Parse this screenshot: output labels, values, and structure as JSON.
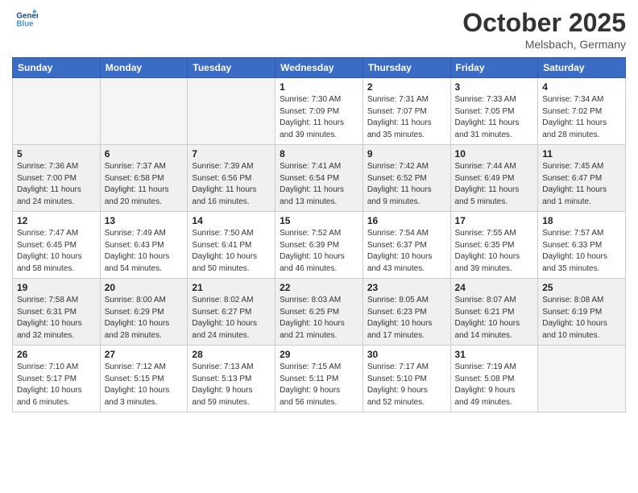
{
  "header": {
    "logo_line1": "General",
    "logo_line2": "Blue",
    "month_title": "October 2025",
    "location": "Melsbach, Germany"
  },
  "days_of_week": [
    "Sunday",
    "Monday",
    "Tuesday",
    "Wednesday",
    "Thursday",
    "Friday",
    "Saturday"
  ],
  "weeks": [
    [
      {
        "day": "",
        "info": ""
      },
      {
        "day": "",
        "info": ""
      },
      {
        "day": "",
        "info": ""
      },
      {
        "day": "1",
        "info": "Sunrise: 7:30 AM\nSunset: 7:09 PM\nDaylight: 11 hours\nand 39 minutes."
      },
      {
        "day": "2",
        "info": "Sunrise: 7:31 AM\nSunset: 7:07 PM\nDaylight: 11 hours\nand 35 minutes."
      },
      {
        "day": "3",
        "info": "Sunrise: 7:33 AM\nSunset: 7:05 PM\nDaylight: 11 hours\nand 31 minutes."
      },
      {
        "day": "4",
        "info": "Sunrise: 7:34 AM\nSunset: 7:02 PM\nDaylight: 11 hours\nand 28 minutes."
      }
    ],
    [
      {
        "day": "5",
        "info": "Sunrise: 7:36 AM\nSunset: 7:00 PM\nDaylight: 11 hours\nand 24 minutes."
      },
      {
        "day": "6",
        "info": "Sunrise: 7:37 AM\nSunset: 6:58 PM\nDaylight: 11 hours\nand 20 minutes."
      },
      {
        "day": "7",
        "info": "Sunrise: 7:39 AM\nSunset: 6:56 PM\nDaylight: 11 hours\nand 16 minutes."
      },
      {
        "day": "8",
        "info": "Sunrise: 7:41 AM\nSunset: 6:54 PM\nDaylight: 11 hours\nand 13 minutes."
      },
      {
        "day": "9",
        "info": "Sunrise: 7:42 AM\nSunset: 6:52 PM\nDaylight: 11 hours\nand 9 minutes."
      },
      {
        "day": "10",
        "info": "Sunrise: 7:44 AM\nSunset: 6:49 PM\nDaylight: 11 hours\nand 5 minutes."
      },
      {
        "day": "11",
        "info": "Sunrise: 7:45 AM\nSunset: 6:47 PM\nDaylight: 11 hours\nand 1 minute."
      }
    ],
    [
      {
        "day": "12",
        "info": "Sunrise: 7:47 AM\nSunset: 6:45 PM\nDaylight: 10 hours\nand 58 minutes."
      },
      {
        "day": "13",
        "info": "Sunrise: 7:49 AM\nSunset: 6:43 PM\nDaylight: 10 hours\nand 54 minutes."
      },
      {
        "day": "14",
        "info": "Sunrise: 7:50 AM\nSunset: 6:41 PM\nDaylight: 10 hours\nand 50 minutes."
      },
      {
        "day": "15",
        "info": "Sunrise: 7:52 AM\nSunset: 6:39 PM\nDaylight: 10 hours\nand 46 minutes."
      },
      {
        "day": "16",
        "info": "Sunrise: 7:54 AM\nSunset: 6:37 PM\nDaylight: 10 hours\nand 43 minutes."
      },
      {
        "day": "17",
        "info": "Sunrise: 7:55 AM\nSunset: 6:35 PM\nDaylight: 10 hours\nand 39 minutes."
      },
      {
        "day": "18",
        "info": "Sunrise: 7:57 AM\nSunset: 6:33 PM\nDaylight: 10 hours\nand 35 minutes."
      }
    ],
    [
      {
        "day": "19",
        "info": "Sunrise: 7:58 AM\nSunset: 6:31 PM\nDaylight: 10 hours\nand 32 minutes."
      },
      {
        "day": "20",
        "info": "Sunrise: 8:00 AM\nSunset: 6:29 PM\nDaylight: 10 hours\nand 28 minutes."
      },
      {
        "day": "21",
        "info": "Sunrise: 8:02 AM\nSunset: 6:27 PM\nDaylight: 10 hours\nand 24 minutes."
      },
      {
        "day": "22",
        "info": "Sunrise: 8:03 AM\nSunset: 6:25 PM\nDaylight: 10 hours\nand 21 minutes."
      },
      {
        "day": "23",
        "info": "Sunrise: 8:05 AM\nSunset: 6:23 PM\nDaylight: 10 hours\nand 17 minutes."
      },
      {
        "day": "24",
        "info": "Sunrise: 8:07 AM\nSunset: 6:21 PM\nDaylight: 10 hours\nand 14 minutes."
      },
      {
        "day": "25",
        "info": "Sunrise: 8:08 AM\nSunset: 6:19 PM\nDaylight: 10 hours\nand 10 minutes."
      }
    ],
    [
      {
        "day": "26",
        "info": "Sunrise: 7:10 AM\nSunset: 5:17 PM\nDaylight: 10 hours\nand 6 minutes."
      },
      {
        "day": "27",
        "info": "Sunrise: 7:12 AM\nSunset: 5:15 PM\nDaylight: 10 hours\nand 3 minutes."
      },
      {
        "day": "28",
        "info": "Sunrise: 7:13 AM\nSunset: 5:13 PM\nDaylight: 9 hours\nand 59 minutes."
      },
      {
        "day": "29",
        "info": "Sunrise: 7:15 AM\nSunset: 5:11 PM\nDaylight: 9 hours\nand 56 minutes."
      },
      {
        "day": "30",
        "info": "Sunrise: 7:17 AM\nSunset: 5:10 PM\nDaylight: 9 hours\nand 52 minutes."
      },
      {
        "day": "31",
        "info": "Sunrise: 7:19 AM\nSunset: 5:08 PM\nDaylight: 9 hours\nand 49 minutes."
      },
      {
        "day": "",
        "info": ""
      }
    ]
  ]
}
